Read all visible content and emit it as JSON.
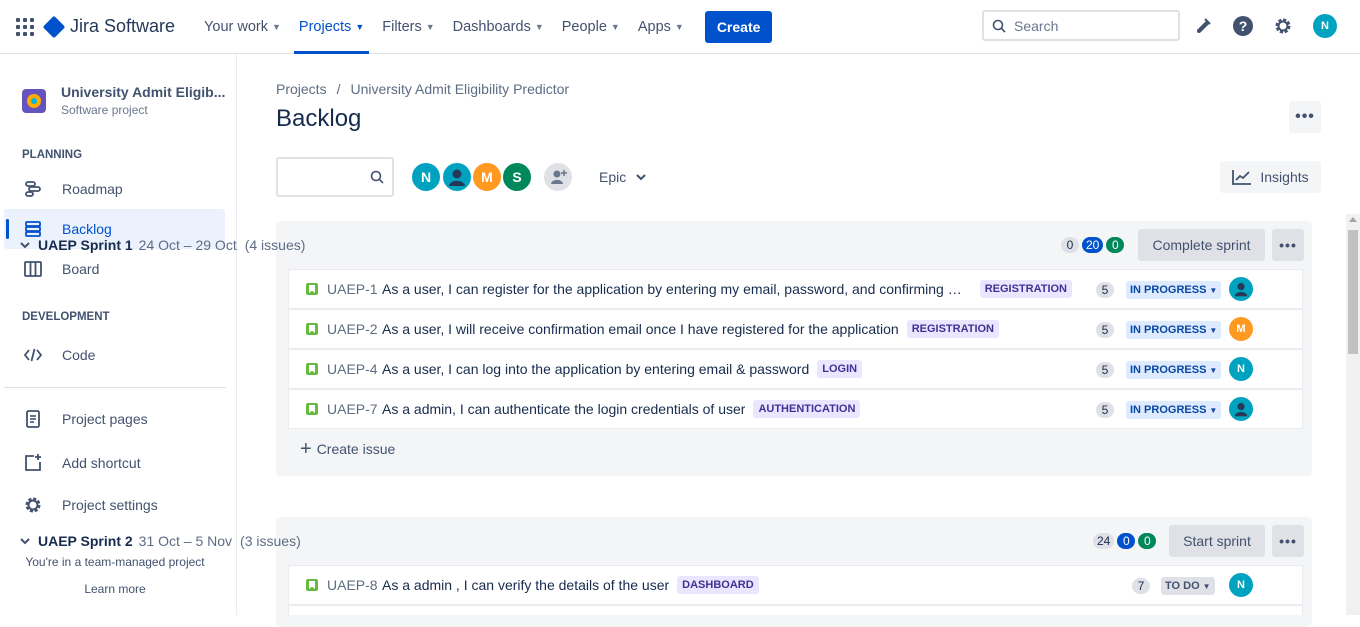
{
  "topnav": {
    "app_name": "Jira Software",
    "items": [
      {
        "label": "Your work",
        "active": false
      },
      {
        "label": "Projects",
        "active": true
      },
      {
        "label": "Filters",
        "active": false
      },
      {
        "label": "Dashboards",
        "active": false
      },
      {
        "label": "People",
        "active": false
      },
      {
        "label": "Apps",
        "active": false
      }
    ],
    "create_label": "Create",
    "search_placeholder": "Search",
    "user_initial": "N"
  },
  "sidebar": {
    "project_name": "University Admit Eligib...",
    "project_type": "Software project",
    "planning_label": "PLANNING",
    "planning_items": [
      "Roadmap",
      "Backlog",
      "Board"
    ],
    "development_label": "DEVELOPMENT",
    "development_items": [
      "Code"
    ],
    "other_items": [
      "Project pages",
      "Add shortcut",
      "Project settings"
    ],
    "footer_text": "You're in a team-managed project",
    "footer_link": "Learn more"
  },
  "main": {
    "breadcrumb_root": "Projects",
    "breadcrumb_separator": "/",
    "breadcrumb_project": "University Admit Eligibility Predictor",
    "title": "Backlog",
    "epic_filter": "Epic",
    "insights_label": "Insights",
    "avatars": [
      {
        "initial": "N",
        "color": "#00A3BF"
      },
      {
        "initial": "",
        "color": "#00A3BF"
      },
      {
        "initial": "M",
        "color": "#FF991F"
      },
      {
        "initial": "S",
        "color": "#00875A"
      }
    ]
  },
  "sprints": [
    {
      "name": "UAEP Sprint 1",
      "dates": "24 Oct – 29 Oct",
      "count": "(4 issues)",
      "todo": "0",
      "in_progress": "20",
      "done": "0",
      "action": "Complete sprint",
      "create_issue": "Create issue",
      "issues": [
        {
          "key": "UAEP-1",
          "summary": "As a user, I can register for the application by entering my email, password, and confirming my password",
          "epic": "REGISTRATION",
          "points": "5",
          "status": "IN PROGRESS",
          "assignee": "",
          "assignee_color": "#00A3BF"
        },
        {
          "key": "UAEP-2",
          "summary": "As a user, I will receive confirmation email once I have registered for the application",
          "epic": "REGISTRATION",
          "points": "5",
          "status": "IN PROGRESS",
          "assignee": "M",
          "assignee_color": "#FF991F"
        },
        {
          "key": "UAEP-4",
          "summary": "As a user, I can log into the application by entering email & password",
          "epic": "LOGIN",
          "points": "5",
          "status": "IN PROGRESS",
          "assignee": "N",
          "assignee_color": "#00A3BF"
        },
        {
          "key": "UAEP-7",
          "summary": "As a admin, I can authenticate the login credentials of user",
          "epic": "AUTHENTICATION",
          "points": "5",
          "status": "IN PROGRESS",
          "assignee": "",
          "assignee_color": "#00A3BF"
        }
      ]
    },
    {
      "name": "UAEP Sprint 2",
      "dates": "31 Oct – 5 Nov",
      "count": "(3 issues)",
      "todo": "24",
      "in_progress": "0",
      "done": "0",
      "action": "Start sprint",
      "issues": [
        {
          "key": "UAEP-8",
          "summary": "As a admin , I can verify the details of the user",
          "epic": "DASHBOARD",
          "points": "7",
          "status": "TO DO",
          "assignee": "N",
          "assignee_color": "#00A3BF"
        }
      ]
    }
  ]
}
